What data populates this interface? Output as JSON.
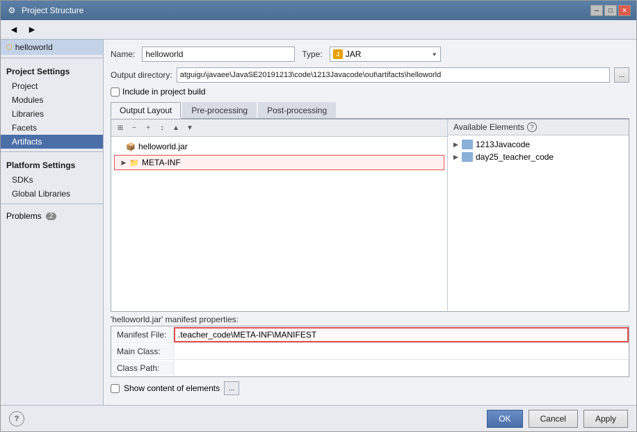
{
  "window": {
    "title": "Project Structure",
    "icon": "⚙"
  },
  "toolbar": {
    "back_label": "◀",
    "forward_label": "▶"
  },
  "sidebar": {
    "artifact_name": "helloworld",
    "project_settings_header": "Project Settings",
    "items": [
      {
        "id": "project",
        "label": "Project"
      },
      {
        "id": "modules",
        "label": "Modules"
      },
      {
        "id": "libraries",
        "label": "Libraries"
      },
      {
        "id": "facets",
        "label": "Facets"
      },
      {
        "id": "artifacts",
        "label": "Artifacts",
        "active": true
      }
    ],
    "platform_settings_header": "Platform Settings",
    "platform_items": [
      {
        "id": "sdks",
        "label": "SDKs"
      },
      {
        "id": "global-libraries",
        "label": "Global Libraries"
      }
    ],
    "problems_label": "Problems",
    "problems_count": "2"
  },
  "right_panel": {
    "name_label": "Name:",
    "name_value": "helloworld",
    "type_label": "Type:",
    "type_value": "JAR",
    "output_dir_label": "Output directory:",
    "output_dir_value": "atguigu\\javaee\\JavaSE20191213\\code\\1213Javacode\\out\\artifacts\\helloworld",
    "include_in_build_label": "Include in project build",
    "tabs": [
      {
        "id": "output-layout",
        "label": "Output Layout",
        "active": true
      },
      {
        "id": "pre-processing",
        "label": "Pre-processing"
      },
      {
        "id": "post-processing",
        "label": "Post-processing"
      }
    ],
    "tree_toolbar": {
      "btn1": "⊞",
      "btn2": "−",
      "btn3": "+",
      "btn4": "↕",
      "btn5": "▲",
      "btn6": "▼"
    },
    "tree_items": [
      {
        "id": "helloworld-jar",
        "label": "helloworld.jar",
        "type": "jar",
        "level": 0,
        "expanded": false
      },
      {
        "id": "meta-inf",
        "label": "META-INF",
        "type": "folder",
        "level": 1,
        "expanded": false,
        "highlighted": true
      }
    ],
    "available_elements_label": "Available Elements",
    "elements_items": [
      {
        "id": "1213javacode",
        "label": "1213Javacode",
        "type": "folder",
        "expanded": false
      },
      {
        "id": "day25-teacher-code",
        "label": "day25_teacher_code",
        "type": "folder",
        "expanded": false
      }
    ],
    "manifest_title": "'helloworld.jar' manifest properties:",
    "manifest_file_label": "Manifest File:",
    "manifest_file_value": ".teacher_code\\META-INF\\MANIFEST",
    "main_class_label": "Main Class:",
    "main_class_value": "",
    "class_path_label": "Class Path:",
    "class_path_value": "",
    "show_content_label": "Show content of elements",
    "ellipsis_label": "..."
  },
  "footer": {
    "ok_label": "OK",
    "cancel_label": "Cancel",
    "apply_label": "Apply"
  }
}
